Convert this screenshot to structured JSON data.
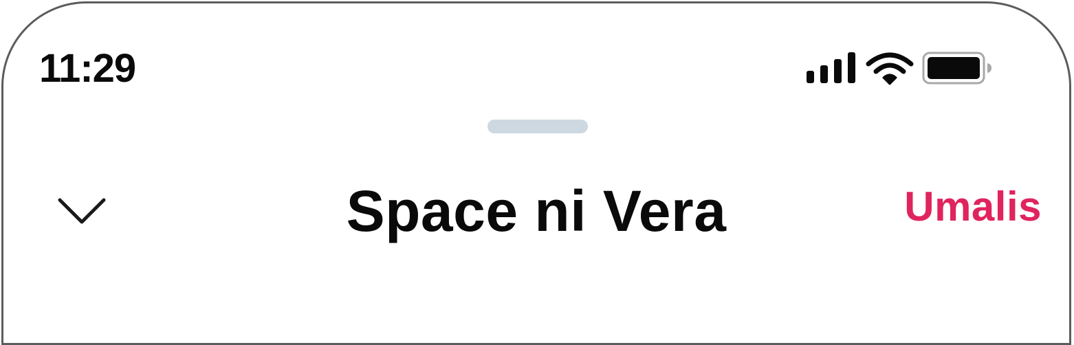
{
  "status_bar": {
    "time": "11:29",
    "icons": [
      "signal-icon",
      "wifi-icon",
      "battery-icon"
    ]
  },
  "header": {
    "title": "Space ni Vera",
    "collapse_icon": "chevron-down-icon",
    "leave_label": "Umalis"
  },
  "colors": {
    "accent": "#e0245e",
    "text": "#0a0a0a",
    "grabber": "#cdd8e0",
    "background": "#ffffff"
  }
}
